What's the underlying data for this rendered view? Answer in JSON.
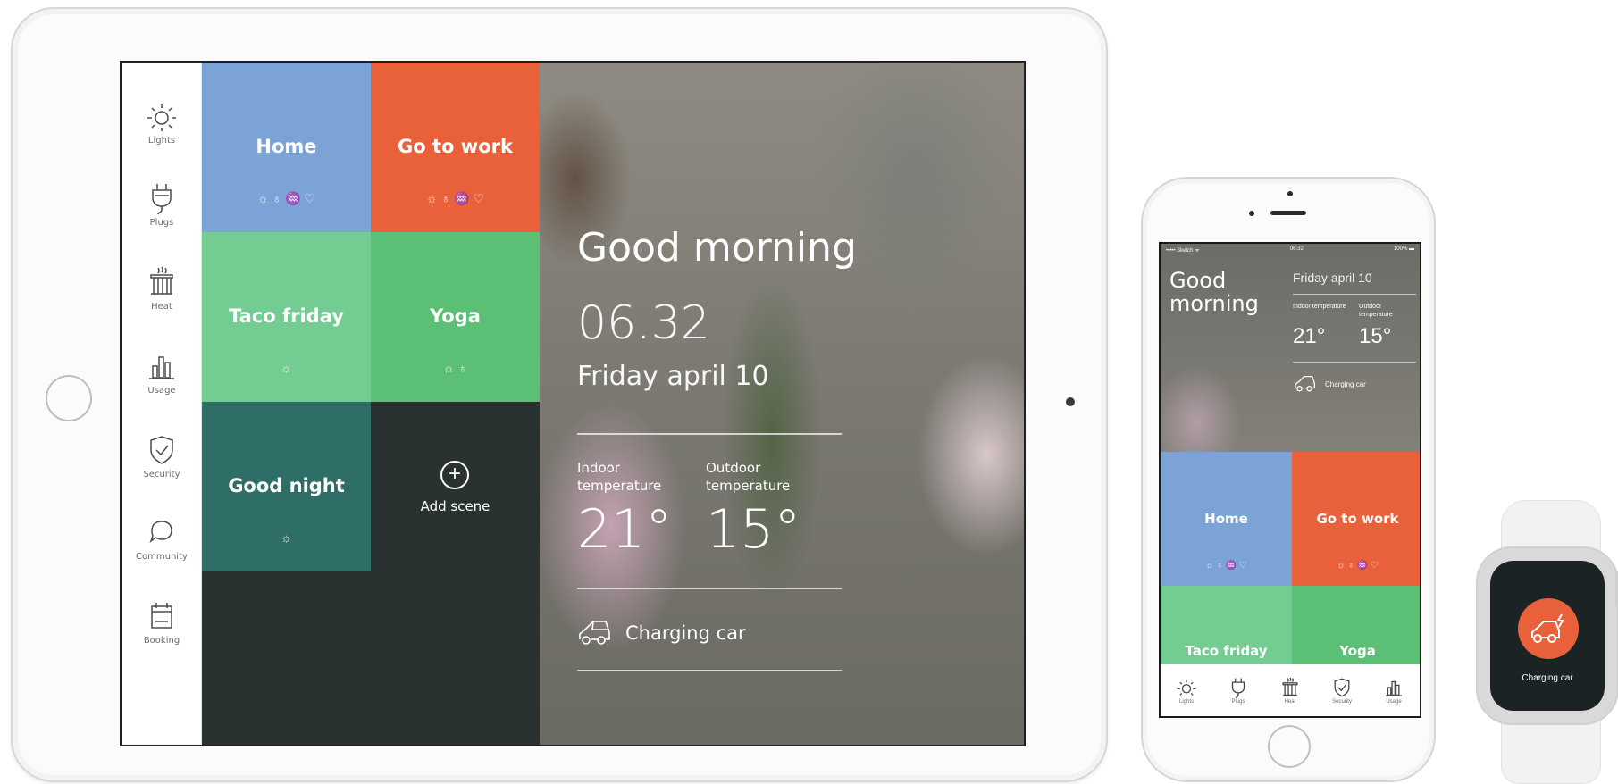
{
  "ipad": {
    "sidebar": [
      {
        "label": "Lights",
        "icon": "sun-icon"
      },
      {
        "label": "Plugs",
        "icon": "plug-icon"
      },
      {
        "label": "Heat",
        "icon": "heater-icon"
      },
      {
        "label": "Usage",
        "icon": "bar-chart-icon"
      },
      {
        "label": "Security",
        "icon": "shield-icon"
      },
      {
        "label": "Community",
        "icon": "chat-bubble-icon"
      },
      {
        "label": "Booking",
        "icon": "calendar-icon"
      }
    ],
    "scenes": [
      {
        "title": "Home",
        "color": "#7ba3d6",
        "icons": "☼ ♁ ♒ ♡"
      },
      {
        "title": "Go to work",
        "color": "#e8613a",
        "icons": "☼ ♁ ♒ ♡"
      },
      {
        "title": "Taco friday",
        "color": "#73cc91",
        "icons": "☼"
      },
      {
        "title": "Yoga",
        "color": "#5bbf76",
        "icons": "☼ ♁"
      },
      {
        "title": "Good night",
        "color": "#2f6e66",
        "icons": "☼"
      }
    ],
    "add_scene_label": "Add scene",
    "greeting": "Good morning",
    "time": "06.32",
    "date": "Friday april 10",
    "indoor_label": "Indoor temperature",
    "outdoor_label": "Outdoor temperature",
    "indoor_temp": "21°",
    "outdoor_temp": "15°",
    "car_status": "Charging car"
  },
  "iphone": {
    "status_left": "••••• Sketch ᯤ",
    "status_time": "06:32",
    "status_right": "100% ▬",
    "greeting": "Good morning",
    "date": "Friday april 10",
    "indoor_label": "Indoor temperature",
    "outdoor_label": "Outdoor temperature",
    "indoor_temp": "21°",
    "outdoor_temp": "15°",
    "car_status": "Charging car",
    "scenes": [
      {
        "title": "Home",
        "color": "#7ba3d6",
        "icons": "☼ ♁ ♒ ♡"
      },
      {
        "title": "Go to work",
        "color": "#e8613a",
        "icons": "☼ ♁ ♒ ♡"
      },
      {
        "title": "Taco friday",
        "color": "#73cc91"
      },
      {
        "title": "Yoga",
        "color": "#5bbf76"
      }
    ],
    "tabs": [
      {
        "label": "Lights",
        "icon": "sun-icon"
      },
      {
        "label": "Plugs",
        "icon": "plug-icon"
      },
      {
        "label": "Heat",
        "icon": "heater-icon"
      },
      {
        "label": "Security",
        "icon": "shield-icon"
      },
      {
        "label": "Usage",
        "icon": "bar-chart-icon"
      }
    ]
  },
  "watch": {
    "label": "Charging car",
    "color": "#e8613a"
  }
}
